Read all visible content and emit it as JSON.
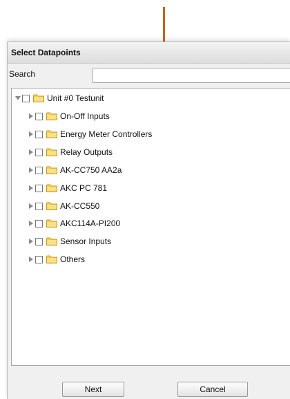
{
  "dialog": {
    "title": "Select Datapoints",
    "search": {
      "label": "Search",
      "value": "",
      "placeholder": ""
    },
    "tree": {
      "root": {
        "label": "Unit #0  Testunit",
        "expanded": true,
        "checked": false
      },
      "children": [
        {
          "label": "On-Off Inputs",
          "expanded": false,
          "checked": false
        },
        {
          "label": "Energy Meter Controllers",
          "expanded": false,
          "checked": false
        },
        {
          "label": "Relay Outputs",
          "expanded": false,
          "checked": false
        },
        {
          "label": "AK-CC750 AA2a",
          "expanded": false,
          "checked": false
        },
        {
          "label": "AKC PC 781",
          "expanded": false,
          "checked": false
        },
        {
          "label": "AK-CC550",
          "expanded": false,
          "checked": false
        },
        {
          "label": "AKC114A-PI200",
          "expanded": false,
          "checked": false
        },
        {
          "label": "Sensor Inputs",
          "expanded": false,
          "checked": false
        },
        {
          "label": "Others",
          "expanded": false,
          "checked": false
        }
      ]
    },
    "buttons": {
      "next": "Next",
      "cancel": "Cancel"
    }
  },
  "icons": {
    "expand": "triangle-right-icon",
    "collapse": "triangle-down-icon",
    "folder": "folder-icon",
    "checkbox": "checkbox-icon"
  },
  "colors": {
    "annotation_line": "#c8641e",
    "folder_fill": "#f6cf57",
    "folder_stroke": "#c99a1c",
    "toggle": "#8a8a8a"
  }
}
